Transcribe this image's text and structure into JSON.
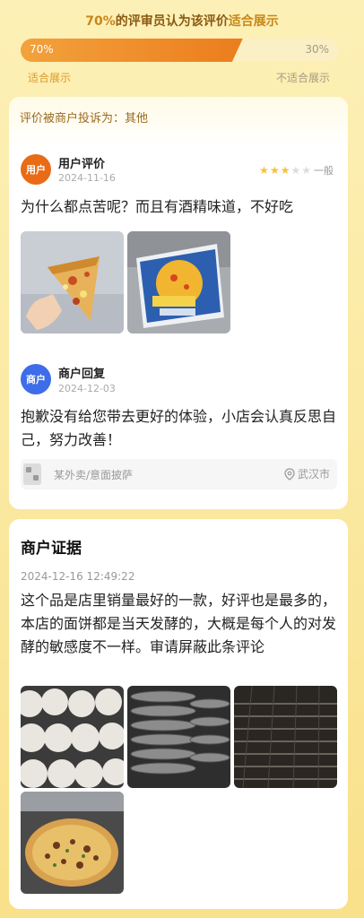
{
  "header": {
    "percent_text": "70%",
    "mid_text": "的评审员认为该评价",
    "end_text": "适合展示",
    "bar": {
      "left_fraction": 0.7,
      "left_pct": "70%",
      "right_pct": "30%"
    },
    "left_label": "适合展示",
    "right_label": "不适合展示"
  },
  "review_card": {
    "complaint_label": "评价被商户投诉为：其他",
    "user": {
      "avatar_text": "用户",
      "name": "用户评价",
      "date": "2024-11-16",
      "rating": 3,
      "rating_max": 5,
      "rating_text": "一般",
      "content": "为什么都点苦呢？而且有酒精味道，不好吃",
      "photos": [
        "pizza-slice-photo",
        "pizza-box-photo"
      ]
    },
    "merchant": {
      "avatar_text": "商户",
      "name": "商户回复",
      "date": "2024-12-03",
      "content": "抱歉没有给您带去更好的体验，小店会认真反思自己，努力改善！"
    },
    "shop": {
      "name": "某外卖/意面披萨",
      "location": "武汉市"
    }
  },
  "evidence_card": {
    "title": "商户证据",
    "time": "2024-12-16 12:49:22",
    "content": "这个品是店里销量最好的一款，好评也是最多的，本店的面饼都是当天发酵的，大概是每个人的对发酵的敏感度不一样。审请屏蔽此条评论",
    "photos": [
      "dough-balls-photo",
      "pizza-pans-photo",
      "oven-rack-photo",
      "baked-pizza-photo"
    ]
  },
  "colors": {
    "accent_orange": "#ec7d1e",
    "star_yellow": "#f5c23a",
    "merchant_blue": "#3d6de8"
  }
}
